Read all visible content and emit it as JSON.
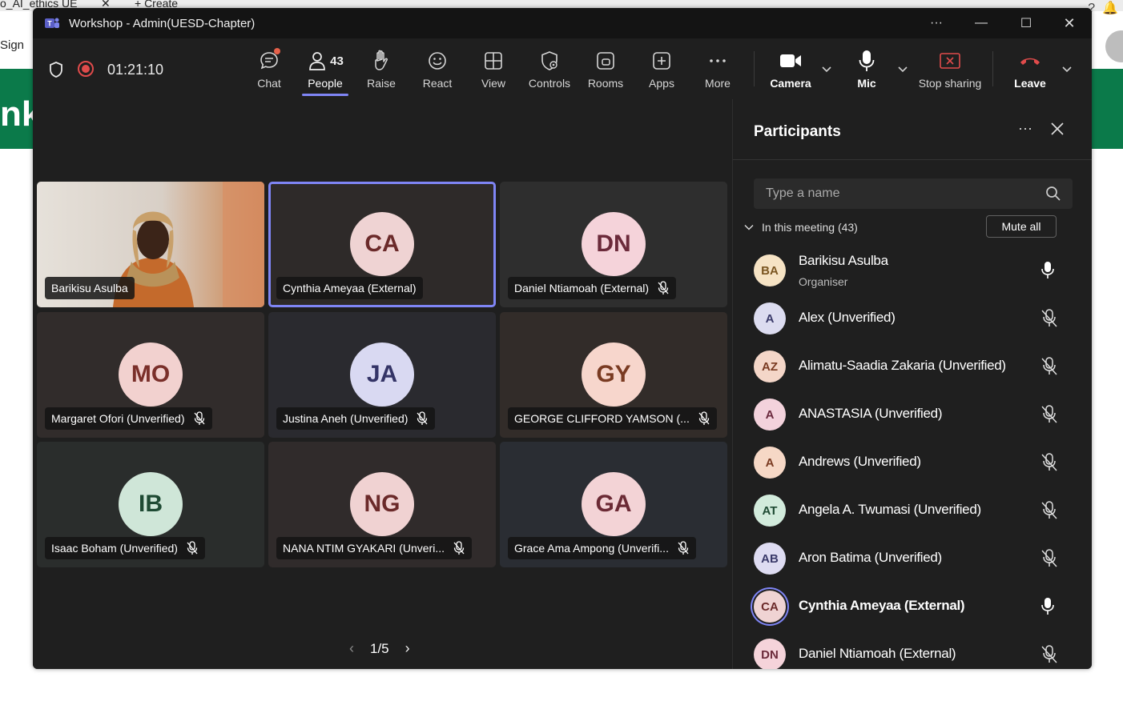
{
  "background": {
    "tab_text": "o_AI_ethics UE",
    "tab_close": "✕",
    "new_tab": "+ Create",
    "sign": "Sign",
    "green_text": "nk"
  },
  "window": {
    "title": "Workshop - Admin(UESD-Chapter)",
    "controls": {
      "more": "···",
      "minimize": "—",
      "maximize": "☐",
      "close": "✕"
    }
  },
  "toolbar": {
    "timer": "01:21:10",
    "people_count": "43",
    "buttons": {
      "chat": "Chat",
      "people": "People",
      "raise": "Raise",
      "react": "React",
      "view": "View",
      "controls": "Controls",
      "rooms": "Rooms",
      "apps": "Apps",
      "more": "More",
      "camera": "Camera",
      "mic": "Mic",
      "stop_sharing": "Stop sharing",
      "leave": "Leave"
    },
    "accent_color": "#7f85f5",
    "leave_color": "#e04b4b"
  },
  "stage": {
    "tiles": [
      {
        "name": "Barikisu Asulba",
        "initials": "",
        "muted": false,
        "video": true
      },
      {
        "name": "Cynthia Ameyaa (External)",
        "initials": "CA",
        "muted": false,
        "selected": true,
        "avatar_bg": "#efd3d3",
        "avatar_fg": "#6b2a2a"
      },
      {
        "name": "Daniel Ntiamoah (External)",
        "initials": "DN",
        "muted": true,
        "avatar_bg": "#f5d3da",
        "avatar_fg": "#6b2a3a"
      },
      {
        "name": "Margaret Ofori (Unverified)",
        "initials": "MO",
        "muted": true,
        "avatar_bg": "#f2d1cf",
        "avatar_fg": "#7a2f2a"
      },
      {
        "name": "Justina Aneh (Unverified)",
        "initials": "JA",
        "muted": true,
        "avatar_bg": "#d9d9f2",
        "avatar_fg": "#343467"
      },
      {
        "name": "GEORGE CLIFFORD YAMSON (...",
        "initials": "GY",
        "muted": true,
        "avatar_bg": "#f7d6cc",
        "avatar_fg": "#7a3b22"
      },
      {
        "name": "Isaac Boham (Unverified)",
        "initials": "IB",
        "muted": true,
        "avatar_bg": "#cfe6d8",
        "avatar_fg": "#1e4a33"
      },
      {
        "name": "NANA NTIM GYAKARI (Unveri...",
        "initials": "NG",
        "muted": true,
        "avatar_bg": "#f0d2d2",
        "avatar_fg": "#6b2a2a"
      },
      {
        "name": "Grace Ama Ampong (Unverifi...",
        "initials": "GA",
        "muted": true,
        "avatar_bg": "#f3d3d6",
        "avatar_fg": "#6b2a35"
      }
    ],
    "pager": {
      "text": "1/5",
      "prev": "‹",
      "next": "›"
    }
  },
  "panel": {
    "title": "Participants",
    "more": "···",
    "search_placeholder": "Type a name",
    "section_label": "In this meeting (43)",
    "mute_all": "Mute all",
    "participants": [
      {
        "initials": "BA",
        "name": "Barikisu Asulba",
        "role": "Organiser",
        "muted": false,
        "avatar_bg": "#f6e3c4",
        "avatar_fg": "#7a5520"
      },
      {
        "initials": "A",
        "name": "Alex (Unverified)",
        "role": "",
        "muted": true,
        "avatar_bg": "#dcdcf0",
        "avatar_fg": "#3a3a6a"
      },
      {
        "initials": "AZ",
        "name": "Alimatu-Saadia Zakaria (Unverified)",
        "role": "",
        "muted": true,
        "avatar_bg": "#f4d6c8",
        "avatar_fg": "#7a3b22"
      },
      {
        "initials": "A",
        "name": "ANASTASIA (Unverified)",
        "role": "",
        "muted": true,
        "avatar_bg": "#f3d2dc",
        "avatar_fg": "#6b2a3e"
      },
      {
        "initials": "A",
        "name": "Andrews (Unverified)",
        "role": "",
        "muted": true,
        "avatar_bg": "#f6d8c6",
        "avatar_fg": "#7a3b22"
      },
      {
        "initials": "AT",
        "name": "Angela A. Twumasi (Unverified)",
        "role": "",
        "muted": true,
        "avatar_bg": "#d2ebdc",
        "avatar_fg": "#1e4a33"
      },
      {
        "initials": "AB",
        "name": "Aron Batima (Unverified)",
        "role": "",
        "muted": true,
        "avatar_bg": "#dedcf2",
        "avatar_fg": "#3a3a6a"
      },
      {
        "initials": "CA",
        "name": "Cynthia Ameyaa (External)",
        "role": "",
        "muted": false,
        "selected": true,
        "avatar_bg": "#efd3d3",
        "avatar_fg": "#6b2a2a"
      },
      {
        "initials": "DN",
        "name": "Daniel Ntiamoah (External)",
        "role": "",
        "muted": true,
        "avatar_bg": "#f5d3da",
        "avatar_fg": "#6b2a3a"
      }
    ]
  }
}
